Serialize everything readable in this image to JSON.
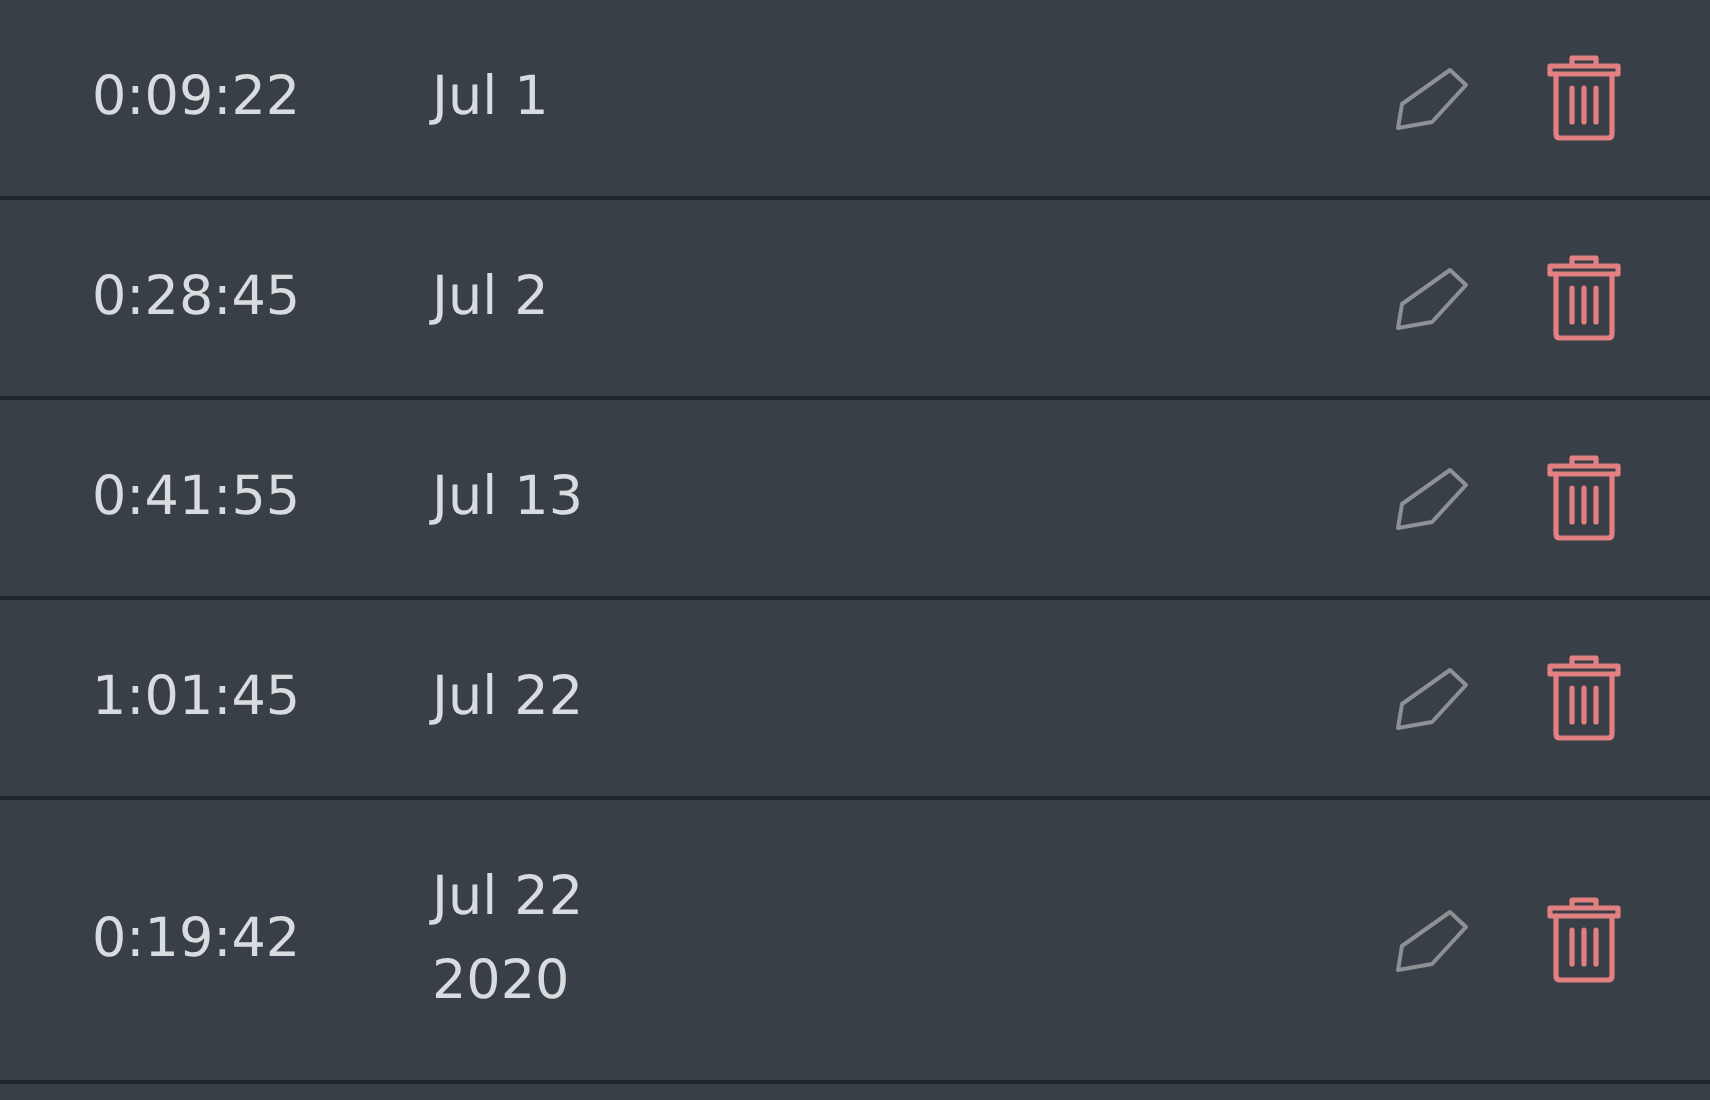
{
  "entries": [
    {
      "duration": "0:09:22",
      "date": "Jul 1"
    },
    {
      "duration": "0:28:45",
      "date": "Jul 2"
    },
    {
      "duration": "0:41:55",
      "date": "Jul 13"
    },
    {
      "duration": "1:01:45",
      "date": "Jul 22"
    },
    {
      "duration": "0:19:42",
      "date": "Jul 22 2020"
    }
  ]
}
